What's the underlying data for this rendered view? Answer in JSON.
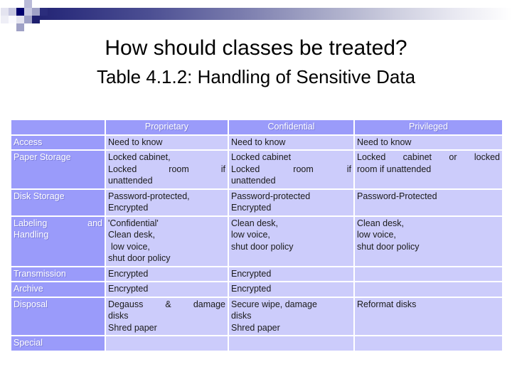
{
  "header": {
    "decor_name": "powerpoint-corner-motif",
    "gradient_from": "#1e1f6e",
    "gradient_to": "#ffffff"
  },
  "slide": {
    "title": "How should classes be treated?",
    "subtitle": "Table 4.1.2: Handling of Sensitive Data"
  },
  "colors": {
    "header_cell": "#9a9bfa",
    "body_cell": "#ccccfb",
    "header_text": "#ffffff",
    "body_text": "#1a1a1a",
    "slide_background": "#ffffff"
  },
  "table": {
    "corner_label": "",
    "columns": [
      "Proprietary",
      "Confidential",
      "Privileged"
    ],
    "rows": [
      {
        "label": "Access",
        "label_justified": false,
        "cells": [
          {
            "lines": [
              "Need to know"
            ],
            "justified_lines": []
          },
          {
            "lines": [
              "Need to know"
            ],
            "justified_lines": []
          },
          {
            "lines": [
              "Need to know"
            ],
            "justified_lines": []
          }
        ]
      },
      {
        "label": "Paper Storage",
        "label_justified": false,
        "cells": [
          {
            "lines": [
              "Locked cabinet,",
              "Locked      room      if",
              "unattended"
            ],
            "justified_lines": [
              1
            ]
          },
          {
            "lines": [
              "Locked cabinet",
              "Locked      room      if",
              "unattended"
            ],
            "justified_lines": [
              1
            ]
          },
          {
            "lines": [
              "Locked  cabinet  or  locked",
              "room if unattended"
            ],
            "justified_lines": [
              0
            ]
          }
        ]
      },
      {
        "label": "Disk Storage",
        "label_justified": false,
        "cells": [
          {
            "lines": [
              "Password-protected,",
              "Encrypted"
            ],
            "justified_lines": []
          },
          {
            "lines": [
              "Password-protected",
              "Encrypted"
            ],
            "justified_lines": []
          },
          {
            "lines": [
              "Password-Protected"
            ],
            "justified_lines": []
          }
        ]
      },
      {
        "label": "Labeling and Handling",
        "label_justified": true,
        "label_lines": [
          "Labeling      and",
          "Handling"
        ],
        "cells": [
          {
            "lines": [
              "'Confidential'",
              "Clean desk,",
              " low voice,",
              "shut door policy"
            ],
            "justified_lines": []
          },
          {
            "lines": [
              "Clean desk,",
              "low voice,",
              "shut door policy"
            ],
            "justified_lines": []
          },
          {
            "lines": [
              "Clean desk,",
              "low voice,",
              "shut door policy"
            ],
            "justified_lines": []
          }
        ]
      },
      {
        "label": "Transmission",
        "label_justified": false,
        "cells": [
          {
            "lines": [
              "Encrypted"
            ],
            "justified_lines": []
          },
          {
            "lines": [
              "Encrypted"
            ],
            "justified_lines": []
          },
          {
            "lines": [],
            "justified_lines": []
          }
        ]
      },
      {
        "label": "Archive",
        "label_justified": false,
        "cells": [
          {
            "lines": [
              "Encrypted"
            ],
            "justified_lines": []
          },
          {
            "lines": [
              "Encrypted"
            ],
            "justified_lines": []
          },
          {
            "lines": [],
            "justified_lines": []
          }
        ]
      },
      {
        "label": "Disposal",
        "label_justified": false,
        "cells": [
          {
            "lines": [
              "Degauss   &   damage",
              "disks",
              "Shred paper"
            ],
            "justified_lines": [
              0
            ]
          },
          {
            "lines": [
              "Secure wipe, damage",
              "disks",
              "Shred paper"
            ],
            "justified_lines": []
          },
          {
            "lines": [
              "Reformat disks"
            ],
            "justified_lines": []
          }
        ]
      },
      {
        "label": "Special",
        "label_justified": false,
        "cells": [
          {
            "lines": [],
            "justified_lines": []
          },
          {
            "lines": [],
            "justified_lines": []
          },
          {
            "lines": [],
            "justified_lines": []
          }
        ]
      }
    ]
  }
}
